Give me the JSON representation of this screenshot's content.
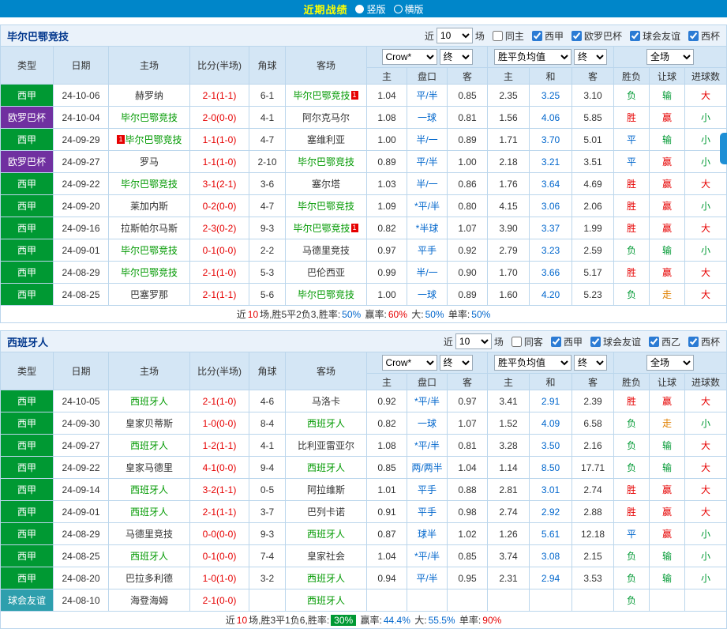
{
  "topbar": {
    "title": "近期战绩",
    "radio_vertical": "竖版",
    "radio_horizontal": "横版"
  },
  "header_cols": [
    "类型",
    "日期",
    "主场",
    "比分(半场)",
    "角球",
    "客场"
  ],
  "sub_cols": [
    "主",
    "盘口",
    "客",
    "主",
    "和",
    "客",
    "胜负",
    "让球",
    "进球数"
  ],
  "selects": {
    "company": "Crow*",
    "company_time": "终",
    "avg": "胜平负均值",
    "avg_time": "终",
    "scope": "全场"
  },
  "filter_labels": {
    "near": "近",
    "count": "10",
    "games": "场"
  },
  "league_colors": {
    "西甲": "#009933",
    "欧罗巴杯": "#7030A0",
    "球会友谊": "#2E9FAD"
  },
  "value_colors": {
    "胜": "#E60000",
    "平": "#0066CC",
    "负": "#009933",
    "赢": "#E60000",
    "输": "#009933",
    "走": "#E08000",
    "大": "#E60000",
    "小": "#009933"
  },
  "sections": [
    {
      "team": "毕尔巴鄂竞技",
      "checkboxes": [
        {
          "label": "同主",
          "checked": false
        },
        {
          "label": "西甲",
          "checked": true
        },
        {
          "label": "欧罗巴杯",
          "checked": true
        },
        {
          "label": "球会友谊",
          "checked": true
        },
        {
          "label": "西杯",
          "checked": true
        }
      ],
      "rows": [
        {
          "league": "西甲",
          "date": "24-10-06",
          "home": "赫罗纳",
          "home_focus": false,
          "score": "2-1(1-1)",
          "corner": "6-1",
          "away": "毕尔巴鄂竞技",
          "away_focus": true,
          "away_badge": "1",
          "odds": [
            "1.04",
            "平/半",
            "0.85"
          ],
          "avg": [
            "2.35",
            "3.25",
            "3.10"
          ],
          "result": "负",
          "handicap": "输",
          "goals": "大"
        },
        {
          "league": "欧罗巴杯",
          "date": "24-10-04",
          "home": "毕尔巴鄂竞技",
          "home_focus": true,
          "score": "2-0(0-0)",
          "corner": "4-1",
          "away": "阿尔克马尔",
          "away_focus": false,
          "odds": [
            "1.08",
            "一球",
            "0.81"
          ],
          "avg": [
            "1.56",
            "4.06",
            "5.85"
          ],
          "result": "胜",
          "handicap": "赢",
          "goals": "小"
        },
        {
          "league": "西甲",
          "date": "24-09-29",
          "home": "毕尔巴鄂竞技",
          "home_focus": true,
          "home_badge_pre": "1",
          "score": "1-1(1-0)",
          "corner": "4-7",
          "away": "塞维利亚",
          "away_focus": false,
          "odds": [
            "1.00",
            "半/一",
            "0.89"
          ],
          "avg": [
            "1.71",
            "3.70",
            "5.01"
          ],
          "result": "平",
          "handicap": "输",
          "goals": "小"
        },
        {
          "league": "欧罗巴杯",
          "date": "24-09-27",
          "home": "罗马",
          "home_focus": false,
          "score": "1-1(1-0)",
          "corner": "2-10",
          "away": "毕尔巴鄂竞技",
          "away_focus": true,
          "odds": [
            "0.89",
            "平/半",
            "1.00"
          ],
          "avg": [
            "2.18",
            "3.21",
            "3.51"
          ],
          "result": "平",
          "handicap": "赢",
          "goals": "小"
        },
        {
          "league": "西甲",
          "date": "24-09-22",
          "home": "毕尔巴鄂竞技",
          "home_focus": true,
          "score": "3-1(2-1)",
          "corner": "3-6",
          "away": "塞尔塔",
          "away_focus": false,
          "odds": [
            "1.03",
            "半/一",
            "0.86"
          ],
          "avg": [
            "1.76",
            "3.64",
            "4.69"
          ],
          "result": "胜",
          "handicap": "赢",
          "goals": "大"
        },
        {
          "league": "西甲",
          "date": "24-09-20",
          "home": "莱加内斯",
          "home_focus": false,
          "score": "0-2(0-0)",
          "corner": "4-7",
          "away": "毕尔巴鄂竞技",
          "away_focus": true,
          "odds": [
            "1.09",
            "*平/半",
            "0.80"
          ],
          "avg": [
            "4.15",
            "3.06",
            "2.06"
          ],
          "result": "胜",
          "handicap": "赢",
          "goals": "小"
        },
        {
          "league": "西甲",
          "date": "24-09-16",
          "home": "拉斯帕尔马斯",
          "home_focus": false,
          "score": "2-3(0-2)",
          "corner": "9-3",
          "away": "毕尔巴鄂竞技",
          "away_focus": true,
          "away_badge": "1",
          "odds": [
            "0.82",
            "*半球",
            "1.07"
          ],
          "avg": [
            "3.90",
            "3.37",
            "1.99"
          ],
          "result": "胜",
          "handicap": "赢",
          "goals": "大"
        },
        {
          "league": "西甲",
          "date": "24-09-01",
          "home": "毕尔巴鄂竞技",
          "home_focus": true,
          "score": "0-1(0-0)",
          "corner": "2-2",
          "away": "马德里竞技",
          "away_focus": false,
          "odds": [
            "0.97",
            "平手",
            "0.92"
          ],
          "avg": [
            "2.79",
            "3.23",
            "2.59"
          ],
          "result": "负",
          "handicap": "输",
          "goals": "小"
        },
        {
          "league": "西甲",
          "date": "24-08-29",
          "home": "毕尔巴鄂竞技",
          "home_focus": true,
          "score": "2-1(1-0)",
          "corner": "5-3",
          "away": "巴伦西亚",
          "away_focus": false,
          "odds": [
            "0.99",
            "半/一",
            "0.90"
          ],
          "avg": [
            "1.70",
            "3.66",
            "5.17"
          ],
          "result": "胜",
          "handicap": "赢",
          "goals": "大"
        },
        {
          "league": "西甲",
          "date": "24-08-25",
          "home": "巴塞罗那",
          "home_focus": false,
          "score": "2-1(1-1)",
          "corner": "5-6",
          "away": "毕尔巴鄂竞技",
          "away_focus": true,
          "odds": [
            "1.00",
            "一球",
            "0.89"
          ],
          "avg": [
            "1.60",
            "4.20",
            "5.23"
          ],
          "result": "负",
          "handicap": "走",
          "goals": "大"
        }
      ],
      "summary": [
        {
          "text": "近",
          "color": "#333333"
        },
        {
          "text": "10",
          "color": "#E60000"
        },
        {
          "text": "场,胜5平2负3,胜率:",
          "color": "#333333"
        },
        {
          "text": "50%",
          "color": "#0066CC"
        },
        {
          "text": " 赢率:",
          "color": "#333333"
        },
        {
          "text": "60%",
          "color": "#E60000"
        },
        {
          "text": " 大:",
          "color": "#333333"
        },
        {
          "text": "50%",
          "color": "#0066CC"
        },
        {
          "text": " 单率:",
          "color": "#333333"
        },
        {
          "text": "50%",
          "color": "#0066CC"
        }
      ]
    },
    {
      "team": "西班牙人",
      "checkboxes": [
        {
          "label": "同客",
          "checked": false
        },
        {
          "label": "西甲",
          "checked": true
        },
        {
          "label": "球会友谊",
          "checked": true
        },
        {
          "label": "西乙",
          "checked": true
        },
        {
          "label": "西杯",
          "checked": true
        }
      ],
      "rows": [
        {
          "league": "西甲",
          "date": "24-10-05",
          "home": "西班牙人",
          "home_focus": true,
          "score": "2-1(1-0)",
          "corner": "4-6",
          "away": "马洛卡",
          "away_focus": false,
          "odds": [
            "0.92",
            "*平/半",
            "0.97"
          ],
          "avg": [
            "3.41",
            "2.91",
            "2.39"
          ],
          "result": "胜",
          "handicap": "赢",
          "goals": "大"
        },
        {
          "league": "西甲",
          "date": "24-09-30",
          "home": "皇家贝蒂斯",
          "home_focus": false,
          "score": "1-0(0-0)",
          "corner": "8-4",
          "away": "西班牙人",
          "away_focus": true,
          "odds": [
            "0.82",
            "一球",
            "1.07"
          ],
          "avg": [
            "1.52",
            "4.09",
            "6.58"
          ],
          "result": "负",
          "handicap": "走",
          "goals": "小"
        },
        {
          "league": "西甲",
          "date": "24-09-27",
          "home": "西班牙人",
          "home_focus": true,
          "score": "1-2(1-1)",
          "corner": "4-1",
          "away": "比利亚雷亚尔",
          "away_focus": false,
          "odds": [
            "1.08",
            "*平/半",
            "0.81"
          ],
          "avg": [
            "3.28",
            "3.50",
            "2.16"
          ],
          "result": "负",
          "handicap": "输",
          "goals": "大"
        },
        {
          "league": "西甲",
          "date": "24-09-22",
          "home": "皇家马德里",
          "home_focus": false,
          "score": "4-1(0-0)",
          "corner": "9-4",
          "away": "西班牙人",
          "away_focus": true,
          "odds": [
            "0.85",
            "两/两半",
            "1.04"
          ],
          "avg": [
            "1.14",
            "8.50",
            "17.71"
          ],
          "result": "负",
          "handicap": "输",
          "goals": "大"
        },
        {
          "league": "西甲",
          "date": "24-09-14",
          "home": "西班牙人",
          "home_focus": true,
          "score": "3-2(1-1)",
          "corner": "0-5",
          "away": "阿拉维斯",
          "away_focus": false,
          "odds": [
            "1.01",
            "平手",
            "0.88"
          ],
          "avg": [
            "2.81",
            "3.01",
            "2.74"
          ],
          "result": "胜",
          "handicap": "赢",
          "goals": "大"
        },
        {
          "league": "西甲",
          "date": "24-09-01",
          "home": "西班牙人",
          "home_focus": true,
          "score": "2-1(1-1)",
          "corner": "3-7",
          "away": "巴列卡诺",
          "away_focus": false,
          "odds": [
            "0.91",
            "平手",
            "0.98"
          ],
          "avg": [
            "2.74",
            "2.92",
            "2.88"
          ],
          "result": "胜",
          "handicap": "赢",
          "goals": "大"
        },
        {
          "league": "西甲",
          "date": "24-08-29",
          "home": "马德里竞技",
          "home_focus": false,
          "score": "0-0(0-0)",
          "corner": "9-3",
          "away": "西班牙人",
          "away_focus": true,
          "odds": [
            "0.87",
            "球半",
            "1.02"
          ],
          "avg": [
            "1.26",
            "5.61",
            "12.18"
          ],
          "result": "平",
          "handicap": "赢",
          "goals": "小"
        },
        {
          "league": "西甲",
          "date": "24-08-25",
          "home": "西班牙人",
          "home_focus": true,
          "score": "0-1(0-0)",
          "corner": "7-4",
          "away": "皇家社会",
          "away_focus": false,
          "odds": [
            "1.04",
            "*平/半",
            "0.85"
          ],
          "avg": [
            "3.74",
            "3.08",
            "2.15"
          ],
          "result": "负",
          "handicap": "输",
          "goals": "小"
        },
        {
          "league": "西甲",
          "date": "24-08-20",
          "home": "巴拉多利德",
          "home_focus": false,
          "score": "1-0(1-0)",
          "corner": "3-2",
          "away": "西班牙人",
          "away_focus": true,
          "odds": [
            "0.94",
            "平/半",
            "0.95"
          ],
          "avg": [
            "2.31",
            "2.94",
            "3.53"
          ],
          "result": "负",
          "handicap": "输",
          "goals": "小"
        },
        {
          "league": "球会友谊",
          "date": "24-08-10",
          "home": "海登海姆",
          "home_focus": false,
          "score": "2-1(0-0)",
          "corner": "",
          "away": "西班牙人",
          "away_focus": true,
          "odds": [
            "",
            "",
            ""
          ],
          "avg": [
            "",
            "",
            ""
          ],
          "result": "负",
          "handicap": "",
          "goals": ""
        }
      ],
      "summary": [
        {
          "text": "近",
          "color": "#333333"
        },
        {
          "text": "10",
          "color": "#E60000"
        },
        {
          "text": "场,胜3平1负6,胜率:",
          "color": "#333333"
        },
        {
          "text": "30%",
          "color": "#FFFFFF",
          "bg": "#009933"
        },
        {
          "text": " 赢率:",
          "color": "#333333"
        },
        {
          "text": "44.4%",
          "color": "#0066CC"
        },
        {
          "text": " 大:",
          "color": "#333333"
        },
        {
          "text": "55.5%",
          "color": "#0066CC"
        },
        {
          "text": " 单率:",
          "color": "#333333"
        },
        {
          "text": "90%",
          "color": "#E60000"
        }
      ]
    }
  ]
}
